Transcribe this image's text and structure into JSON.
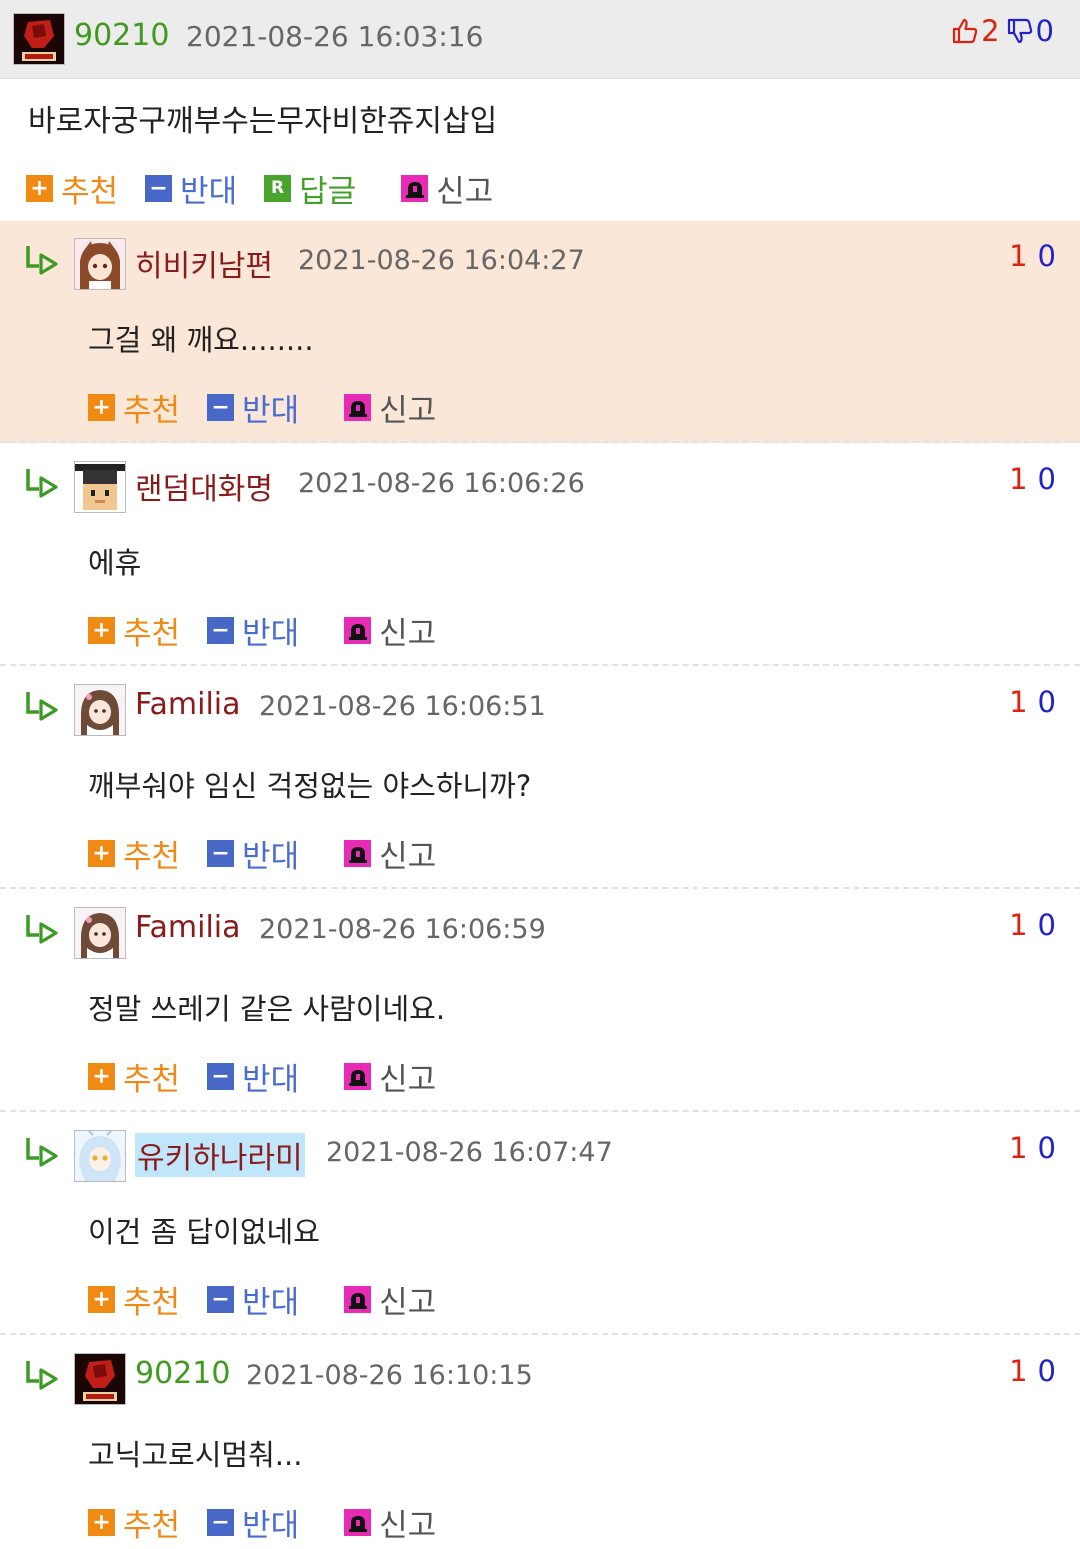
{
  "post": {
    "nickname": "90210",
    "date": "2021-08-26 16:03:16",
    "up_count": "2",
    "down_count": "0",
    "text": "바로자궁구깨부수는무자비한쥬지삽입",
    "actions": {
      "recommend": "추천",
      "oppose": "반대",
      "reply": "답글",
      "report": "신고"
    }
  },
  "comment_actions": {
    "recommend": "추천",
    "oppose": "반대",
    "report": "신고"
  },
  "colors": {
    "nick_green": "#3f9a1e",
    "nick_red": "#8b1b1b",
    "highlight_bg": "#fbe7d7",
    "up": "#dd2211",
    "down": "#2222cc"
  },
  "comments": [
    {
      "nickname": "히비키남편",
      "date": "2021-08-26 16:04:27",
      "up": "1",
      "down": "0",
      "text": "그걸 왜 깨요........",
      "highlighted": true
    },
    {
      "nickname": "랜덤대화명",
      "date": "2021-08-26 16:06:26",
      "up": "1",
      "down": "0",
      "text": "에휴"
    },
    {
      "nickname": "Familia",
      "date": "2021-08-26 16:06:51",
      "up": "1",
      "down": "0",
      "text": "깨부숴야 임신 걱정없는 야스하니까?"
    },
    {
      "nickname": "Familia",
      "date": "2021-08-26 16:06:59",
      "up": "1",
      "down": "0",
      "text": "정말 쓰레기 같은 사람이네요."
    },
    {
      "nickname": "유키하나라미",
      "date": "2021-08-26 16:07:47",
      "up": "1",
      "down": "0",
      "text": "이건 좀 답이없네요"
    },
    {
      "nickname": "90210",
      "date": "2021-08-26 16:10:15",
      "up": "1",
      "down": "0",
      "text": "고닉고로시멈춰..."
    }
  ]
}
